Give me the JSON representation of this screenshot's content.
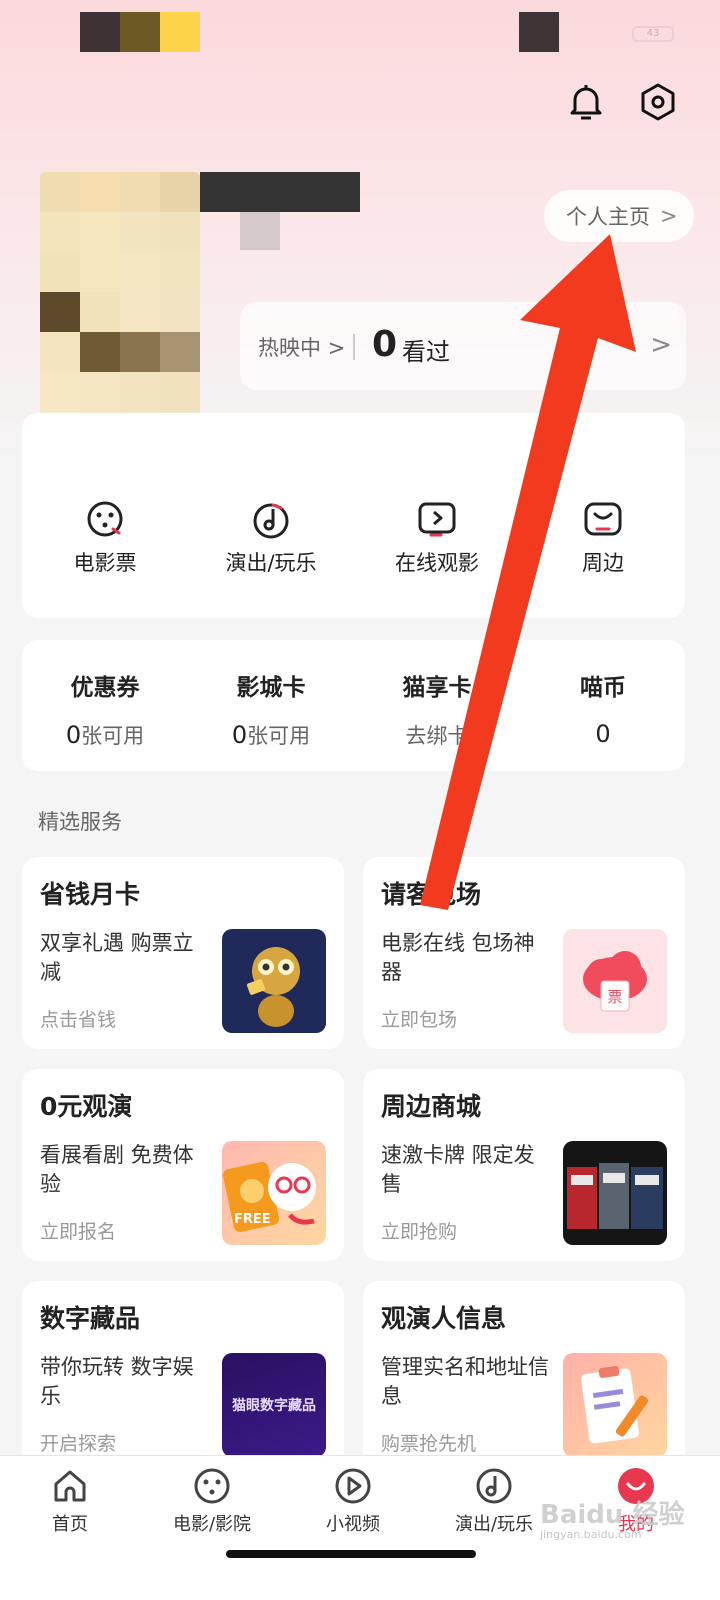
{
  "status_bar": {
    "battery": "43"
  },
  "header": {
    "bell_icon": "bell-icon",
    "settings_icon": "settings-hex-icon"
  },
  "profile": {
    "homepage_label": "个人主页",
    "chevron": ">"
  },
  "watch": {
    "hot_label": "热映中",
    "chevron": ">",
    "watched_count": "0",
    "watched_label": "看过",
    "arrow": ">"
  },
  "orders": [
    {
      "label": "电影票",
      "icon": "film-reel-icon"
    },
    {
      "label": "演出/玩乐",
      "icon": "music-note-icon"
    },
    {
      "label": "在线观影",
      "icon": "play-screen-icon"
    },
    {
      "label": "周边",
      "icon": "smile-box-icon"
    }
  ],
  "wallet": [
    {
      "title": "优惠券",
      "count": "0",
      "unit": "张可用"
    },
    {
      "title": "影城卡",
      "count": "0",
      "unit": "张可用"
    },
    {
      "title": "猫享卡",
      "count": "",
      "unit": "去绑卡"
    },
    {
      "title": "喵币",
      "count": "0",
      "unit": ""
    }
  ],
  "services_title": "精选服务",
  "services": [
    {
      "title": "省钱月卡",
      "desc": "双享礼遇 购票立减",
      "link": "点击省钱",
      "image": "gold-cat-mascot"
    },
    {
      "title": "请客包场",
      "desc": "电影在线 包场神器",
      "link": "立即包场",
      "image": "red-ticket-cloud"
    },
    {
      "title": "0元观演",
      "desc": "看展看剧 免费体验",
      "link": "立即报名",
      "image": "free-cat-mascot"
    },
    {
      "title": "周边商城",
      "desc": "速激卡牌 限定发售",
      "link": "立即抢购",
      "image": "card-boxes"
    },
    {
      "title": "数字藏品",
      "desc": "带你玩转 数字娱乐",
      "link": "开启探索",
      "image_text": "猫眼数字藏品"
    },
    {
      "title": "观演人信息",
      "desc": "管理实名和地址信息",
      "link": "购票抢先机",
      "image": "clipboard-pencil"
    }
  ],
  "tabs": [
    {
      "label": "首页",
      "icon": "home-icon",
      "active": false
    },
    {
      "label": "电影/影院",
      "icon": "film-reel-icon",
      "active": false
    },
    {
      "label": "小视频",
      "icon": "play-circle-icon",
      "active": false
    },
    {
      "label": "演出/玩乐",
      "icon": "music-note-icon",
      "active": false
    },
    {
      "label": "我的",
      "icon": "profile-smile-icon",
      "active": true
    }
  ],
  "watermark": {
    "brand": "Baidu 经验",
    "url": "jingyan.baidu.com"
  },
  "colors": {
    "accent": "#e8384f",
    "arrow": "#f23a1f",
    "background": "#f5f5f5"
  }
}
